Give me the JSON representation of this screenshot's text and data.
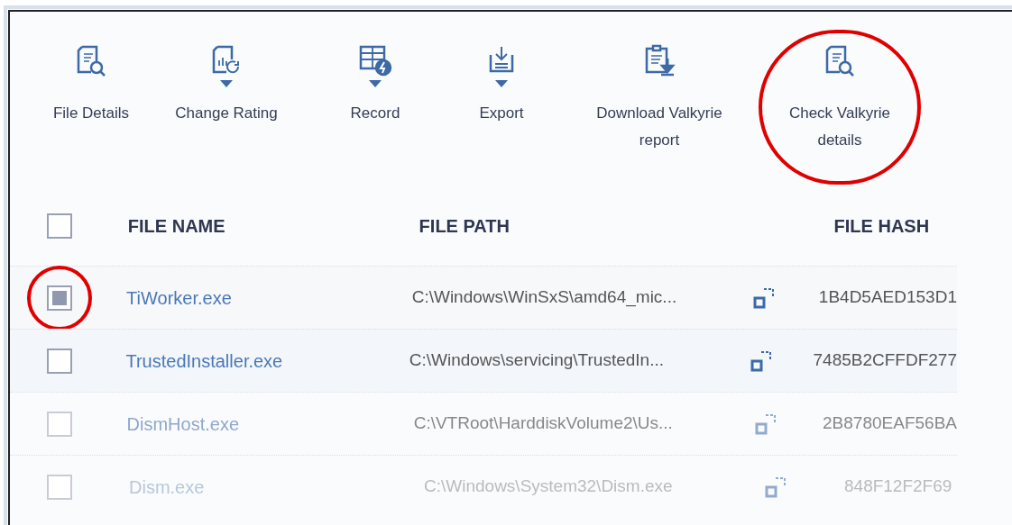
{
  "toolbar": [
    {
      "kind": "details",
      "label": "File Details",
      "dropdown": false,
      "highlighted": false
    },
    {
      "kind": "rating",
      "label": "Change Rating",
      "dropdown": true,
      "highlighted": false
    },
    {
      "kind": "record",
      "label": "Record",
      "dropdown": true,
      "highlighted": false
    },
    {
      "kind": "export",
      "label": "Export",
      "dropdown": true,
      "highlighted": false
    },
    {
      "kind": "download",
      "label": "Download Valkyrie report",
      "dropdown": false,
      "highlighted": false
    },
    {
      "kind": "details",
      "label": "Check Valkyrie details",
      "dropdown": false,
      "highlighted": true
    }
  ],
  "table": {
    "select_all": {
      "checked": false
    },
    "columns": [
      "FILE NAME",
      "FILE PATH",
      "FILE HASH"
    ],
    "rows": [
      {
        "selected": true,
        "highlighted": true,
        "name": "TiWorker.exe",
        "path": "C:\\Windows\\WinSxS\\amd64_mic...",
        "hash": "1B4D5AED153D1"
      },
      {
        "selected": false,
        "highlighted": false,
        "name": "TrustedInstaller.exe",
        "path": "C:\\Windows\\servicing\\TrustedIn...",
        "hash": "7485B2CFFDF277"
      },
      {
        "selected": false,
        "highlighted": false,
        "name": "DismHost.exe",
        "path": "C:\\VTRoot\\HarddiskVolume2\\Us...",
        "hash": "2B8780EAF56BA"
      },
      {
        "selected": false,
        "highlighted": false,
        "name": "Dism.exe",
        "path": "C:\\Windows\\System32\\Dism.exe",
        "hash": "848F12F2F69"
      }
    ]
  }
}
